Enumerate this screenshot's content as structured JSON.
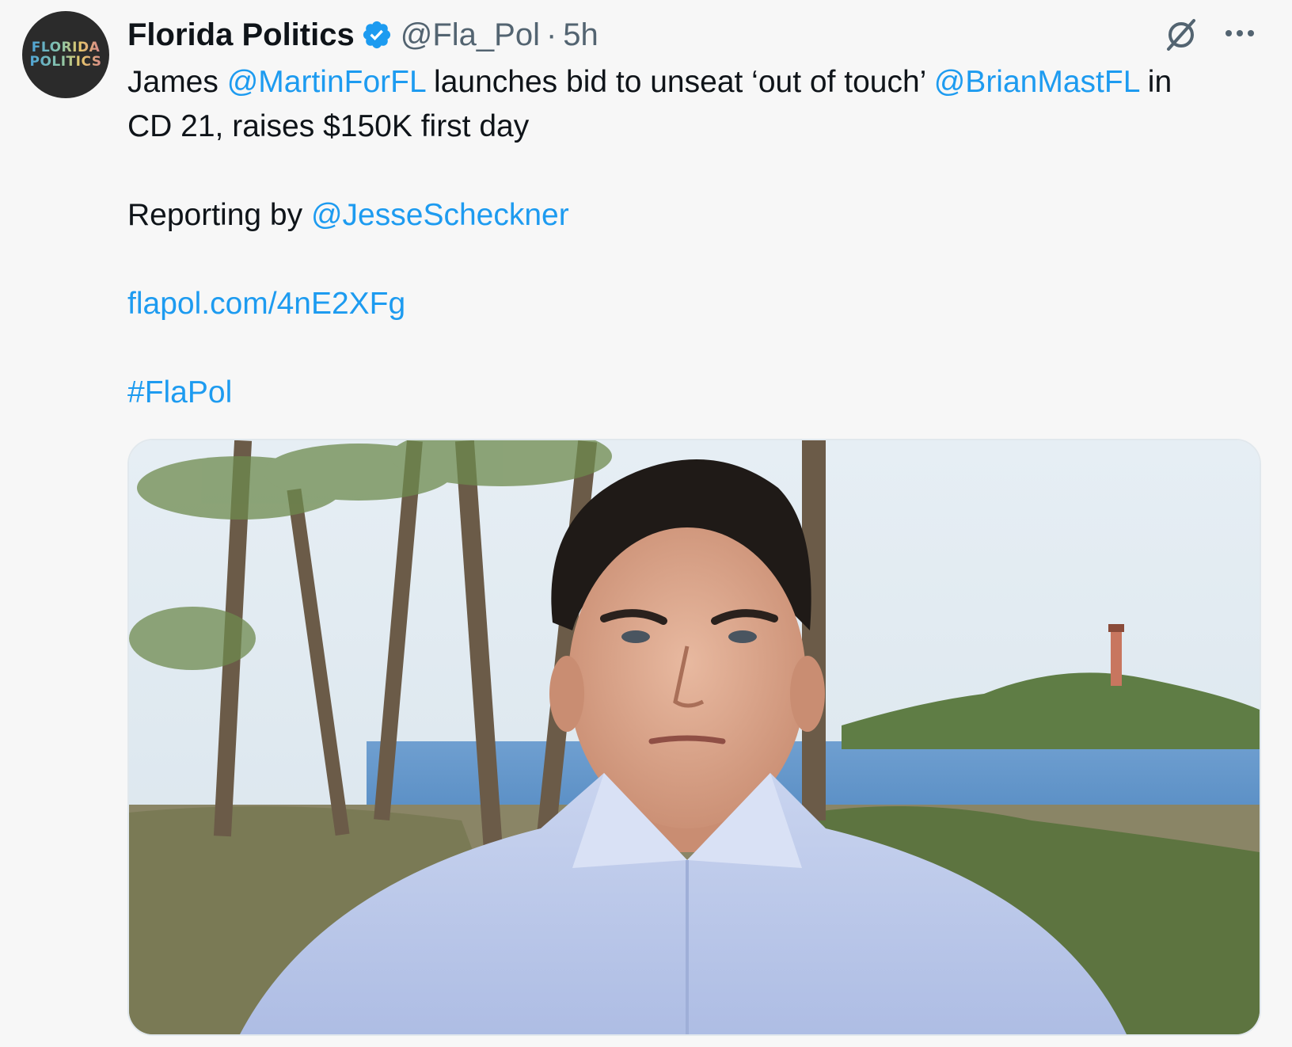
{
  "account": {
    "name": "Florida Politics",
    "handle": "@Fla_Pol",
    "separator": "·",
    "time": "5h",
    "avatar_text_line1": "FLORIDA",
    "avatar_text_line2": "POLITICS",
    "verified_icon": "verified-badge-icon"
  },
  "tweet": {
    "part1": "James ",
    "mention1": "@MartinForFL",
    "part2": " launches bid to unseat ‘out of touch’ ",
    "mention2": "@BrianMastFL",
    "part3": " in",
    "line2": "CD 21, raises $150K first day",
    "reporting_prefix": "Reporting by ",
    "mention3": "@JesseScheckner",
    "url": "flapol.com/4nE2XFg",
    "hashtag": "#FlaPol"
  },
  "icons": {
    "grok": "grok-icon",
    "more": "more-icon"
  },
  "colors": {
    "link": "#1d9bf0",
    "verified": "#1d9bf0",
    "text": "#0f1419",
    "secondary": "#536471",
    "background": "#f7f7f7"
  },
  "media": {
    "description_kind": "photo"
  }
}
